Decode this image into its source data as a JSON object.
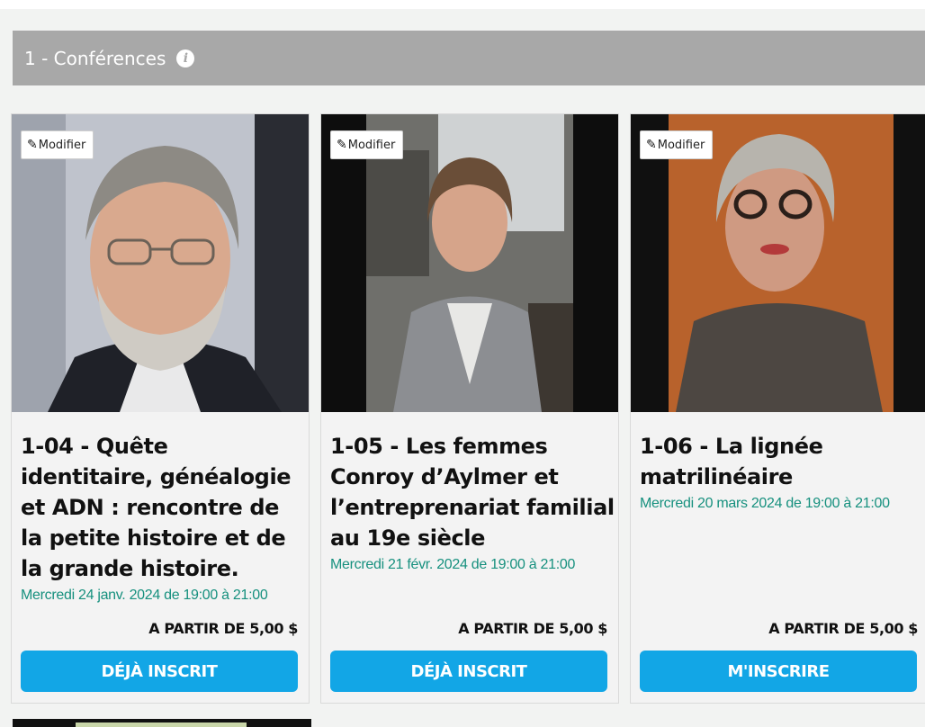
{
  "section": {
    "title": "1 - Conférences",
    "info_icon": "info-icon"
  },
  "cards": [
    {
      "modify_label": "Modifier",
      "title": "1-04 - Quête identitaire, généalogie et ADN : rencontre de la petite histoire et de la grande histoire.",
      "date": "Mercredi 24 janv. 2024 de 19:00 à 21:00",
      "price": "A PARTIR DE 5,00 $",
      "button": "DÉJÀ INSCRIT"
    },
    {
      "modify_label": "Modifier",
      "title": "1-05 - Les femmes Conroy d’Aylmer et l’entreprenariat familial au 19e siècle",
      "date": "Mercredi 21 févr. 2024 de 19:00 à 21:00",
      "price": "A PARTIR DE 5,00 $",
      "button": "DÉJÀ INSCRIT"
    },
    {
      "modify_label": "Modifier",
      "title": "1-06 - La lignée matrilinéaire",
      "date": "Mercredi 20 mars 2024 de 19:00 à 21:00",
      "price": "A PARTIR DE 5,00 $",
      "button": "M'INSCRIRE"
    }
  ],
  "colors": {
    "header_bg": "#a8a8a8",
    "accent_date": "#16907e",
    "button_bg": "#12a6e6"
  }
}
